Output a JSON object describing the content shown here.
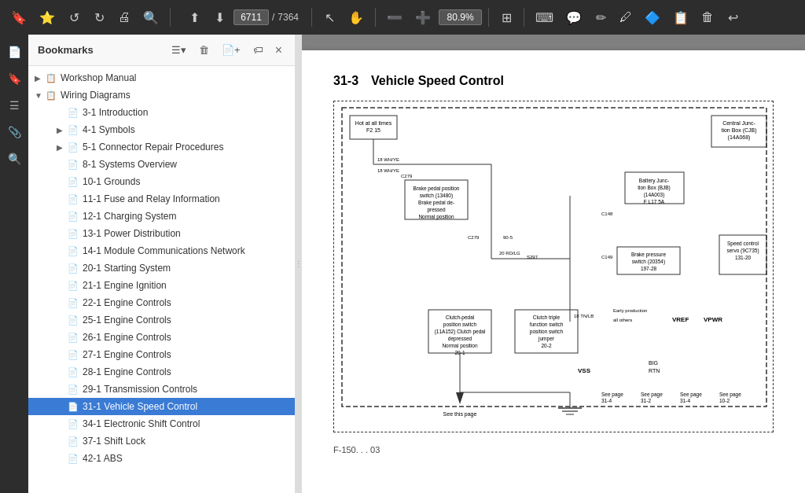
{
  "toolbar": {
    "page_current": "6711",
    "page_total": "7364",
    "zoom": "80.9%",
    "buttons": [
      "bookmark",
      "favorite",
      "back",
      "forward",
      "print",
      "search",
      "zoom-out",
      "zoom-in",
      "cursor",
      "hand",
      "select",
      "annotation",
      "highlight",
      "pen",
      "shapes",
      "stamp",
      "eraser",
      "undo"
    ]
  },
  "sidebar": {
    "title": "Bookmarks",
    "close_label": "×",
    "items": [
      {
        "id": "workshop-manual",
        "label": "Workshop Manual",
        "indent": 0,
        "arrow": "▶",
        "type": "folder",
        "collapsed": true
      },
      {
        "id": "wiring-diagrams",
        "label": "Wiring Diagrams",
        "indent": 0,
        "arrow": "▼",
        "type": "folder",
        "collapsed": false
      },
      {
        "id": "3-1-intro",
        "label": "3-1 Introduction",
        "indent": 1,
        "arrow": "",
        "type": "page"
      },
      {
        "id": "4-1-symbols",
        "label": "4-1 Symbols",
        "indent": 1,
        "arrow": "▶",
        "type": "folder"
      },
      {
        "id": "5-1-connector",
        "label": "5-1 Connector Repair Procedures",
        "indent": 1,
        "arrow": "▶",
        "type": "folder"
      },
      {
        "id": "8-1-systems",
        "label": "8-1 Systems Overview",
        "indent": 1,
        "arrow": "",
        "type": "page"
      },
      {
        "id": "10-1-grounds",
        "label": "10-1 Grounds",
        "indent": 1,
        "arrow": "",
        "type": "page"
      },
      {
        "id": "11-1-fuse",
        "label": "11-1 Fuse and Relay Information",
        "indent": 1,
        "arrow": "",
        "type": "page"
      },
      {
        "id": "12-1-charging",
        "label": "12-1 Charging System",
        "indent": 1,
        "arrow": "",
        "type": "page"
      },
      {
        "id": "13-1-power",
        "label": "13-1 Power Distribution",
        "indent": 1,
        "arrow": "",
        "type": "page"
      },
      {
        "id": "14-1-module",
        "label": "14-1 Module Communications Network",
        "indent": 1,
        "arrow": "",
        "type": "page"
      },
      {
        "id": "20-1-starting",
        "label": "20-1 Starting System",
        "indent": 1,
        "arrow": "",
        "type": "page"
      },
      {
        "id": "21-1-ignition",
        "label": "21-1 Engine Ignition",
        "indent": 1,
        "arrow": "",
        "type": "page"
      },
      {
        "id": "22-1-engine",
        "label": "22-1 Engine Controls",
        "indent": 1,
        "arrow": "",
        "type": "page"
      },
      {
        "id": "25-1-engine",
        "label": "25-1 Engine Controls",
        "indent": 1,
        "arrow": "",
        "type": "page"
      },
      {
        "id": "26-1-engine",
        "label": "26-1 Engine Controls",
        "indent": 1,
        "arrow": "",
        "type": "page"
      },
      {
        "id": "27-1-engine",
        "label": "27-1 Engine Controls",
        "indent": 1,
        "arrow": "",
        "type": "page"
      },
      {
        "id": "28-1-engine",
        "label": "28-1 Engine Controls",
        "indent": 1,
        "arrow": "",
        "type": "page"
      },
      {
        "id": "29-1-transmission",
        "label": "29-1 Transmission Controls",
        "indent": 1,
        "arrow": "",
        "type": "page"
      },
      {
        "id": "31-1-vehicle-speed",
        "label": "31-1 Vehicle Speed Control",
        "indent": 1,
        "arrow": "",
        "type": "page",
        "active": true
      },
      {
        "id": "34-1-electronic",
        "label": "34-1 Electronic Shift Control",
        "indent": 1,
        "arrow": "",
        "type": "page"
      },
      {
        "id": "37-1-shift",
        "label": "37-1 Shift Lock",
        "indent": 1,
        "arrow": "",
        "type": "page"
      },
      {
        "id": "42-1-abs",
        "label": "42-1 ABS",
        "indent": 1,
        "arrow": "",
        "type": "page"
      }
    ]
  },
  "pdf": {
    "section": "31-3",
    "title": "Vehicle Speed Control",
    "footer": "F-150. . . 03"
  }
}
